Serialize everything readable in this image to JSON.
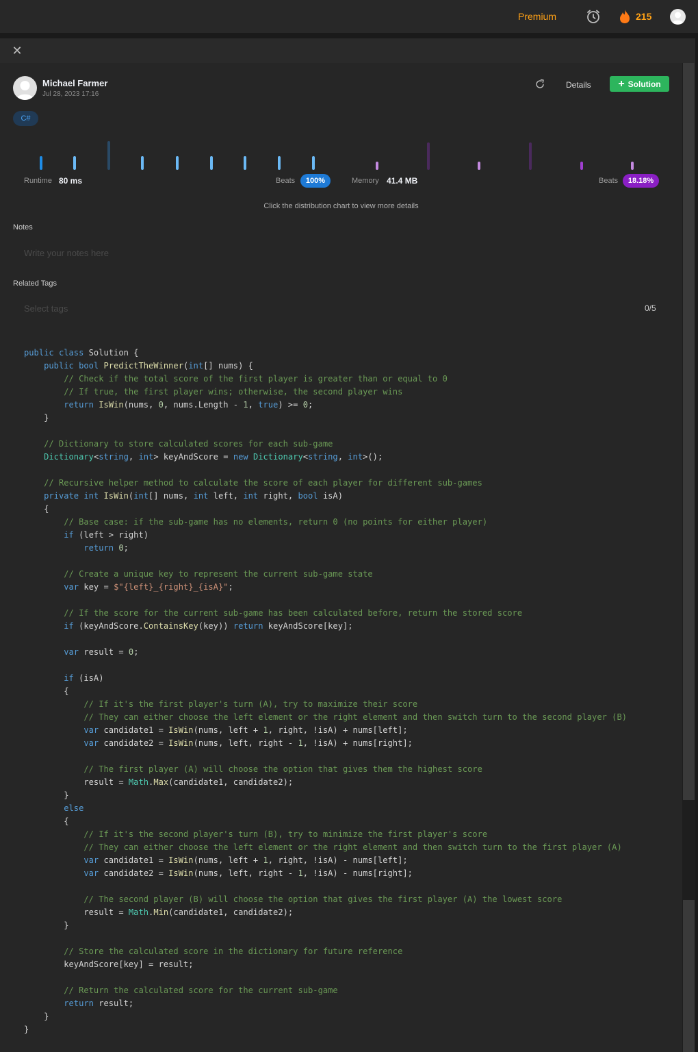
{
  "topbar": {
    "premium_label": "Premium",
    "streak_count": "215",
    "alarm_icon": "alarm-clock-icon",
    "fire_icon": "fire-icon",
    "avatar_icon": "user-avatar-icon"
  },
  "panel": {
    "close_icon": "close-icon"
  },
  "submission": {
    "author": "Michael Farmer",
    "date": "Jul 28, 2023 17:16",
    "details_label": "Details",
    "solution_label": "Solution",
    "language": "C#",
    "share_icon": "share-icon"
  },
  "stats": {
    "runtime_label": "Runtime",
    "runtime_value": "80 ms",
    "runtime_beats_label": "Beats",
    "runtime_beats_value": "100%",
    "memory_label": "Memory",
    "memory_value": "41.4 MB",
    "memory_beats_label": "Beats",
    "memory_beats_value": "18.18%",
    "hint": "Click the distribution chart to view more details",
    "colors": {
      "runtime": "#1e8ce6",
      "memory": "#a03fd1"
    }
  },
  "notes": {
    "label": "Notes",
    "placeholder": "Write your notes here"
  },
  "tags": {
    "label": "Related Tags",
    "placeholder": "Select tags",
    "count": "0/5"
  },
  "code_lines": [
    "public class Solution {",
    "    public bool PredictTheWinner(int[] nums) {",
    "        // Check if the total score of the first player is greater than or equal to 0",
    "        // If true, the first player wins; otherwise, the second player wins",
    "        return IsWin(nums, 0, nums.Length - 1, true) >= 0;",
    "    }",
    "",
    "    // Dictionary to store calculated scores for each sub-game",
    "    Dictionary<string, int> keyAndScore = new Dictionary<string, int>();",
    "",
    "    // Recursive helper method to calculate the score of each player for different sub-games",
    "    private int IsWin(int[] nums, int left, int right, bool isA)",
    "    {",
    "        // Base case: if the sub-game has no elements, return 0 (no points for either player)",
    "        if (left > right)",
    "            return 0;",
    "",
    "        // Create a unique key to represent the current sub-game state",
    "        var key = $\"{left}_{right}_{isA}\";",
    "",
    "        // If the score for the current sub-game has been calculated before, return the stored score",
    "        if (keyAndScore.ContainsKey(key)) return keyAndScore[key];",
    "",
    "        var result = 0;",
    "",
    "        if (isA)",
    "        {",
    "            // If it's the first player's turn (A), try to maximize their score",
    "            // They can either choose the left element or the right element and then switch turn to the second player (B)",
    "            var candidate1 = IsWin(nums, left + 1, right, !isA) + nums[left];",
    "            var candidate2 = IsWin(nums, left, right - 1, !isA) + nums[right];",
    "",
    "            // The first player (A) will choose the option that gives them the highest score",
    "            result = Math.Max(candidate1, candidate2);",
    "        }",
    "        else",
    "        {",
    "            // If it's the second player's turn (B), try to minimize the first player's score",
    "            // They can either choose the left element or the right element and then switch turn to the first player (A)",
    "            var candidate1 = IsWin(nums, left + 1, right, !isA) - nums[left];",
    "            var candidate2 = IsWin(nums, left, right - 1, !isA) - nums[right];",
    "",
    "            // The second player (B) will choose the option that gives the first player (A) the lowest score",
    "            result = Math.Min(candidate1, candidate2);",
    "        }",
    "",
    "        // Store the calculated score in the dictionary for future reference",
    "        keyAndScore[key] = result;",
    "",
    "        // Return the calculated score for the current sub-game",
    "        return result;",
    "    }",
    "}"
  ]
}
